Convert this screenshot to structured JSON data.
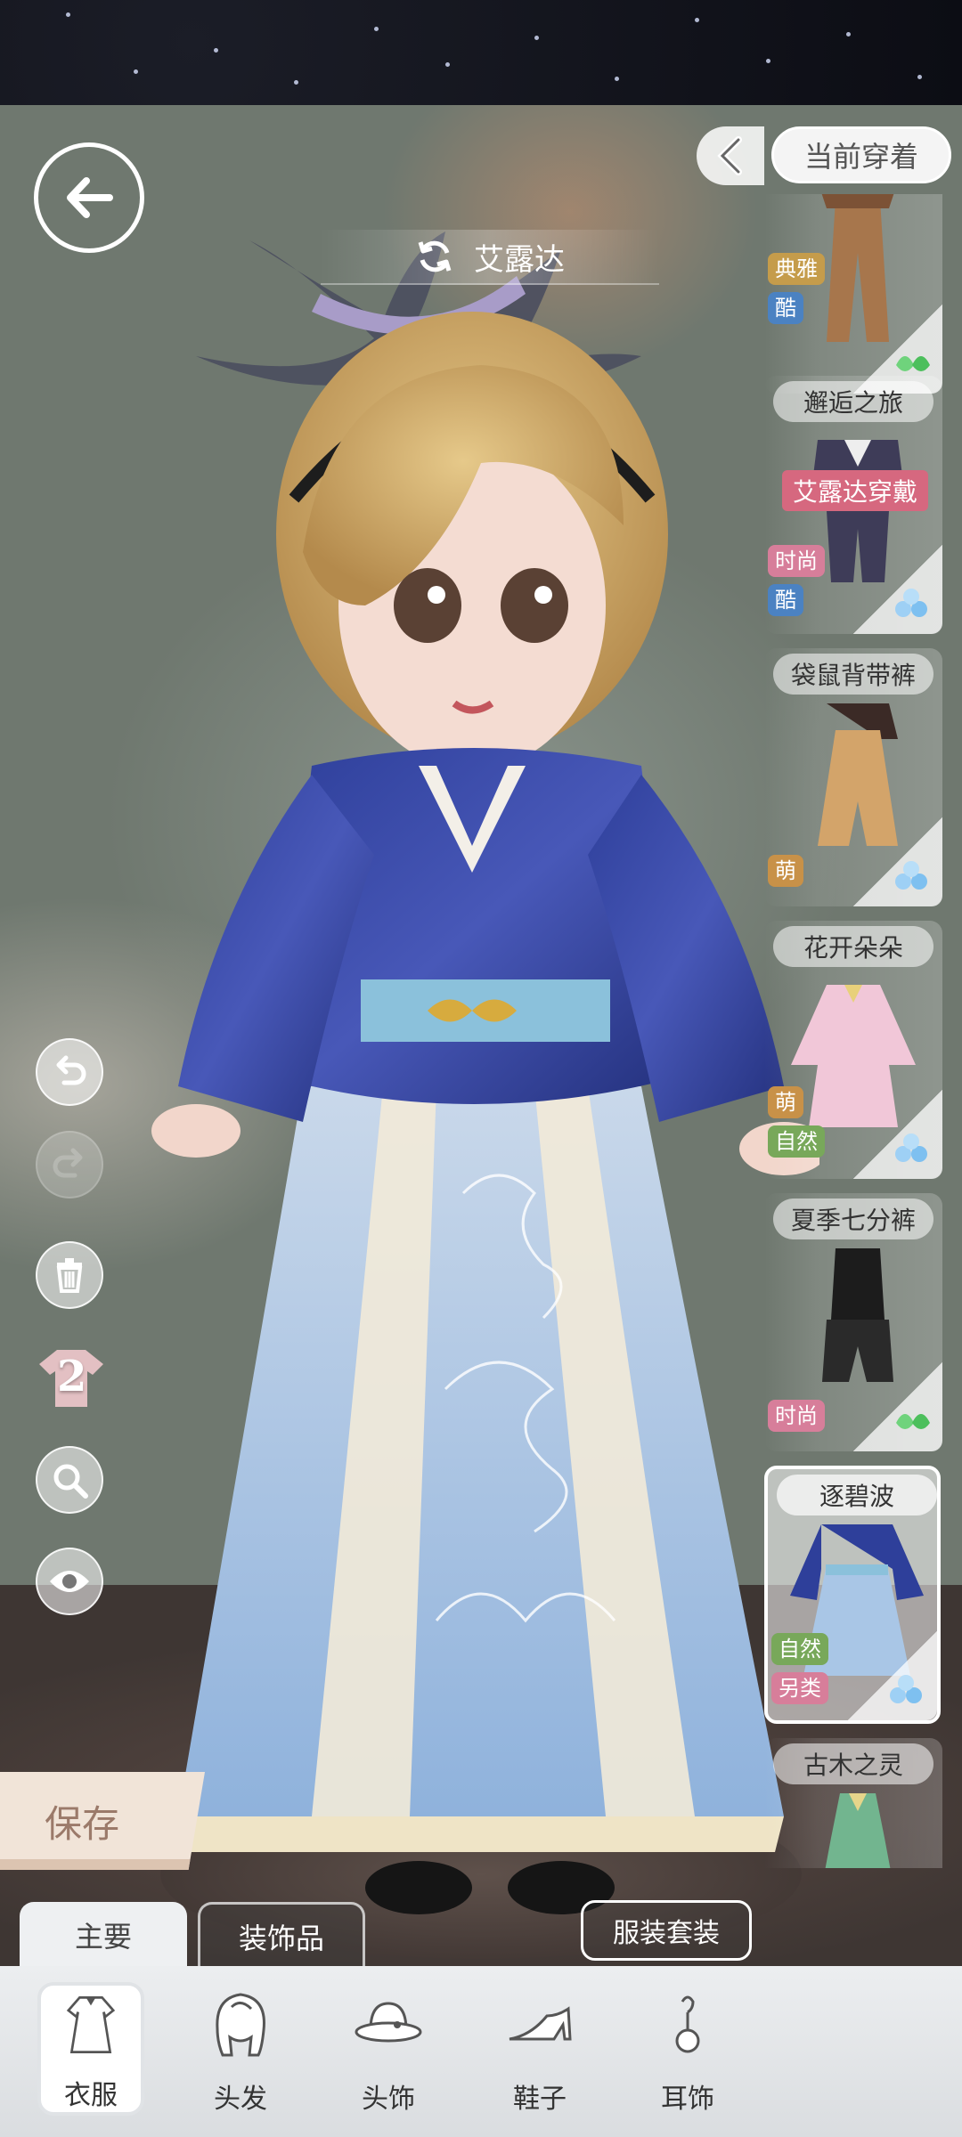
{
  "header": {
    "character_name": "艾露达",
    "current_outfit_label": "当前穿着"
  },
  "items": [
    {
      "title": "",
      "tags": [
        "典雅",
        "酷"
      ],
      "gem": "green"
    },
    {
      "title": "邂逅之旅",
      "wearing": "艾露达穿戴",
      "tags": [
        "时尚",
        "酷"
      ],
      "gem": "blue"
    },
    {
      "title": "袋鼠背带裤",
      "tags": [
        "萌"
      ],
      "gem": "blue"
    },
    {
      "title": "花开朵朵",
      "tags": [
        "萌",
        "自然"
      ],
      "gem": "blue"
    },
    {
      "title": "夏季七分裤",
      "tags": [
        "时尚"
      ],
      "gem": "green"
    },
    {
      "title": "逐碧波",
      "tags": [
        "自然",
        "另类"
      ],
      "gem": "blue",
      "selected": true
    },
    {
      "title": "古木之灵",
      "tags": [],
      "gem": ""
    }
  ],
  "tools": {
    "layer_count": "2"
  },
  "actions": {
    "save_label": "保存",
    "suit_label": "服装套装"
  },
  "sub_tabs": [
    "主要",
    "装饰品"
  ],
  "categories": [
    "衣服",
    "头发",
    "头饰",
    "鞋子",
    "耳饰"
  ],
  "colors": {
    "selected_accent": "#ffffff",
    "wearing_banner": "#d6687f",
    "tag_blue": "#4b82c2",
    "tag_pink": "#d77e9a"
  }
}
